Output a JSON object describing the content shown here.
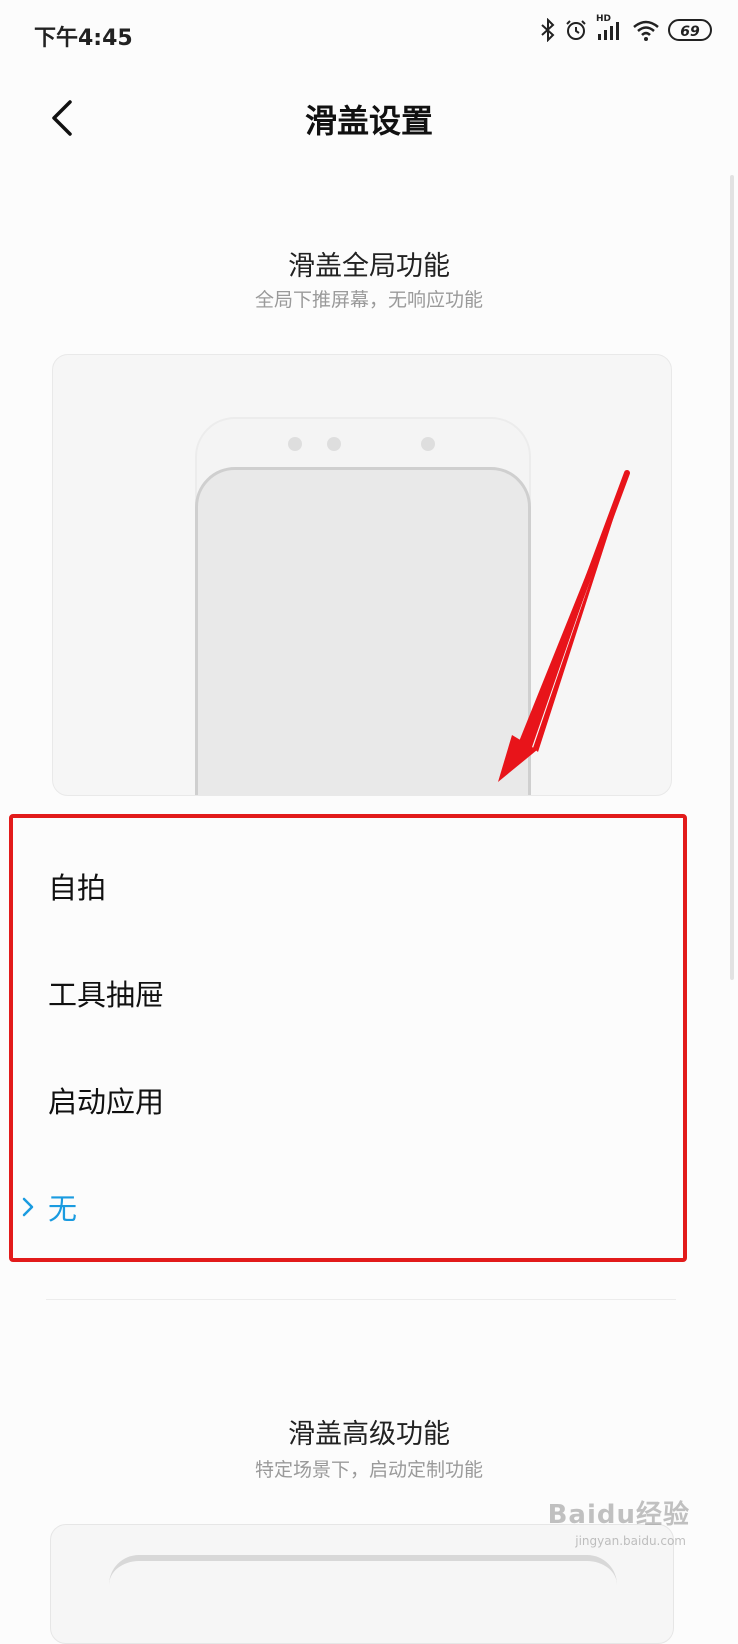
{
  "status_bar": {
    "time": "下午4:45",
    "signal_label": "HD",
    "battery": "69"
  },
  "header": {
    "title": "滑盖设置"
  },
  "global_section": {
    "title": "滑盖全局功能",
    "subtitle": "全局下推屏幕，无响应功能"
  },
  "options": [
    {
      "label": "自拍",
      "selected": false
    },
    {
      "label": "工具抽屉",
      "selected": false
    },
    {
      "label": "启动应用",
      "selected": false
    },
    {
      "label": "无",
      "selected": true
    }
  ],
  "advanced_section": {
    "title": "滑盖高级功能",
    "subtitle": "特定场景下，启动定制功能"
  },
  "watermark": {
    "text": "Baidu经验",
    "sub": "jingyan.baidu.com"
  },
  "colors": {
    "accent": "#1a9be0",
    "highlight": "#e21b1b"
  }
}
